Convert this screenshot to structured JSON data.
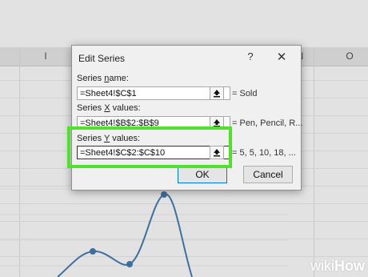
{
  "sheet": {
    "columns_visible": [
      "I",
      "N",
      "O"
    ]
  },
  "dialog": {
    "title": "Edit Series",
    "help": "?",
    "close": "✕",
    "series_name": {
      "label_pre": "Series ",
      "label_u": "n",
      "label_post": "ame:",
      "value": "=Sheet4!$C$1",
      "preview": "= Sold"
    },
    "series_x": {
      "label_pre": "Series ",
      "label_u": "X",
      "label_post": " values:",
      "value": "=Sheet4!$B$2:$B$9",
      "preview": "= Pen, Pencil, R..."
    },
    "series_y": {
      "label_pre": "Series ",
      "label_u": "Y",
      "label_post": " values:",
      "value": "=Sheet4!$C$2:$C$10",
      "preview": "= 5, 5, 10, 18, ..."
    },
    "ok_label": "OK",
    "cancel_label": "Cancel"
  },
  "colors": {
    "highlight": "#4ee32b",
    "chart_line": "#3f6f9f"
  },
  "watermark": {
    "wiki": "wiki",
    "how": "How"
  }
}
